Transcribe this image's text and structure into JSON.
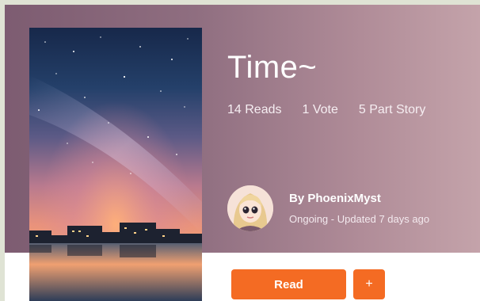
{
  "story": {
    "title": "Time~",
    "stats": {
      "reads": "14 Reads",
      "votes": "1 Vote",
      "parts": "5 Part Story"
    },
    "author": {
      "name": "By PhoenixMyst",
      "status": "Ongoing - Updated 7 days ago"
    }
  },
  "actions": {
    "read_label": "Read",
    "add_label": "+"
  },
  "colors": {
    "accent": "#f46b23",
    "hero_left": "#7d5c71",
    "hero_right": "#c4a3aa"
  },
  "icons": {
    "avatar": "author-avatar-image",
    "cover": "story-cover-image"
  }
}
